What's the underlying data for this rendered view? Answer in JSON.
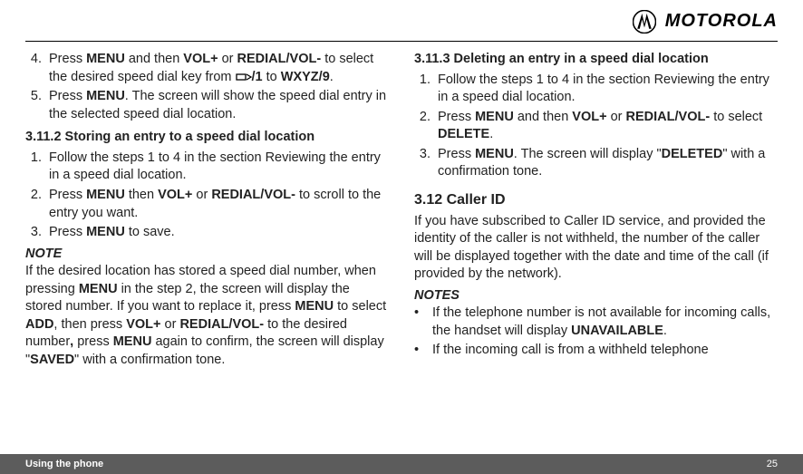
{
  "header": {
    "brand": "MOTOROLA"
  },
  "leftCol": {
    "list1": [
      {
        "n": "4.",
        "prefix": "Press ",
        "b1": "MENU",
        "mid1": " and then ",
        "b2": "VOL+",
        "mid2": " or ",
        "b3": "REDIAL/VOL-",
        "mid3": " to select the desired speed dial key from ",
        "after_icon": "/1",
        "mid4": " to ",
        "b5": "WXYZ/9",
        "suffix": "."
      },
      {
        "n": "5.",
        "prefix": "Press ",
        "b1": "MENU",
        "suffix": ". The screen will show the speed dial entry in the selected speed dial location."
      }
    ],
    "h3112": "3.11.2   Storing an entry to a speed dial location",
    "list2": [
      {
        "n": "1.",
        "text": "Follow the steps 1 to 4 in the section Reviewing the entry in a speed dial location."
      },
      {
        "n": "2.",
        "prefix": "Press ",
        "b1": "MENU",
        "mid1": " then ",
        "b2": "VOL+",
        "mid2": " or ",
        "b3": "REDIAL/VOL-",
        "suffix": " to scroll to the entry you want."
      },
      {
        "n": "3.",
        "prefix": "Press ",
        "b1": "MENU",
        "suffix": " to save."
      }
    ],
    "noteLabel": "NOTE",
    "noteBody": {
      "p1a": "If the desired location has stored a speed dial number, when pressing ",
      "b1": "MENU",
      "p1b": " in the step 2, the screen will display the stored number. If you want to replace it, press ",
      "b2": "MENU",
      "p1c": " to select ",
      "b3": "ADD",
      "p1d": ", then press ",
      "b4": "VOL+",
      "p1e": " or ",
      "b5": "REDIAL/VOL-",
      "p1f": " to the desired number",
      "b6": ",",
      "p1g": " press ",
      "b7": "MENU",
      "p1h": " again to confirm, the screen will display \"",
      "b8": "SAVED",
      "p1i": "\" with a confirmation tone."
    }
  },
  "rightCol": {
    "h3113": "3.11.3   Deleting an entry in a speed dial location",
    "list3": [
      {
        "n": "1.",
        "text": "Follow the steps 1 to 4 in the section Reviewing the entry in a speed dial location."
      },
      {
        "n": "2.",
        "prefix": "Press ",
        "b1": "MENU",
        "mid1": " and then ",
        "b2": "VOL+",
        "mid2": " or ",
        "b3": "REDIAL/VOL-",
        "mid3": " to select ",
        "b4": "DELETE",
        "suffix": "."
      },
      {
        "n": "3.",
        "prefix": "Press ",
        "b1": "MENU",
        "mid1": ". The screen will display \"",
        "b2": "DELETED",
        "suffix": "\" with a confirmation tone."
      }
    ],
    "h312": "3.12   Caller ID",
    "callerIdBody": "If you have subscribed to Caller ID service, and provided the identity of the caller is not withheld, the number of the caller will be displayed together with the date and time of the call (if provided by the network).",
    "notesLabel": "NOTES",
    "bullets": [
      {
        "p1": "If the telephone number is not available for incoming calls, the handset will display ",
        "b1": "UNAVAILABLE",
        "p2": "."
      },
      {
        "p1": "If the incoming call is from a withheld telephone"
      }
    ]
  },
  "footer": {
    "title": "Using the phone",
    "page": "25"
  }
}
